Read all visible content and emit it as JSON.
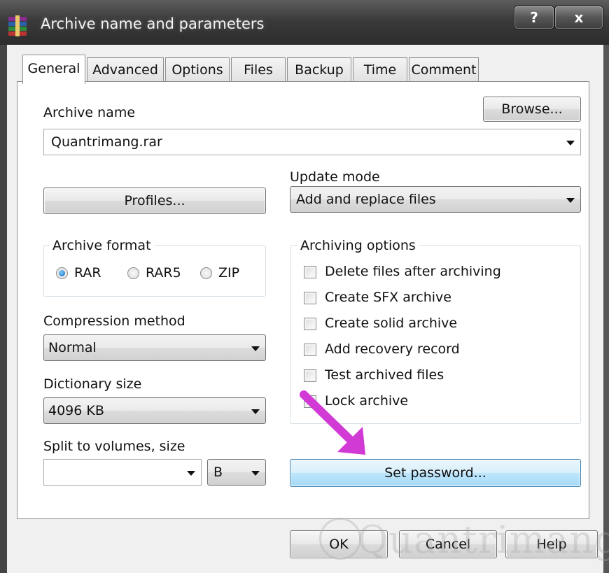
{
  "window": {
    "title": "Archive name and parameters",
    "help_button": "?",
    "close_button": "x"
  },
  "tabs": [
    {
      "label": "General",
      "active": true
    },
    {
      "label": "Advanced"
    },
    {
      "label": "Options"
    },
    {
      "label": "Files"
    },
    {
      "label": "Backup"
    },
    {
      "label": "Time"
    },
    {
      "label": "Comment"
    }
  ],
  "archive_name": {
    "label": "Archive name",
    "value": "Quantrimang.rar",
    "browse_button": "Browse..."
  },
  "update_mode": {
    "label": "Update mode",
    "value": "Add and replace files"
  },
  "profiles_button": "Profiles...",
  "archive_format": {
    "label": "Archive format",
    "options": [
      {
        "label": "RAR",
        "selected": true
      },
      {
        "label": "RAR5",
        "selected": false
      },
      {
        "label": "ZIP",
        "selected": false
      }
    ]
  },
  "compression_method": {
    "label": "Compression method",
    "value": "Normal"
  },
  "dictionary_size": {
    "label": "Dictionary size",
    "value": "4096 KB"
  },
  "split_volumes": {
    "label": "Split to volumes, size",
    "value": "",
    "unit": "B"
  },
  "archiving_options": {
    "label": "Archiving options",
    "items": [
      {
        "label": "Delete files after archiving",
        "checked": false
      },
      {
        "label": "Create SFX archive",
        "checked": false
      },
      {
        "label": "Create solid archive",
        "checked": false
      },
      {
        "label": "Add recovery record",
        "checked": false
      },
      {
        "label": "Test archived files",
        "checked": false
      },
      {
        "label": "Lock archive",
        "checked": false
      }
    ]
  },
  "set_password_button": "Set password...",
  "footer": {
    "ok": "OK",
    "cancel": "Cancel",
    "help": "Help"
  },
  "watermark": "Quantrimang",
  "colors": {
    "annotation_arrow": "#d23ad6",
    "highlight_button": "#bee6fd"
  }
}
